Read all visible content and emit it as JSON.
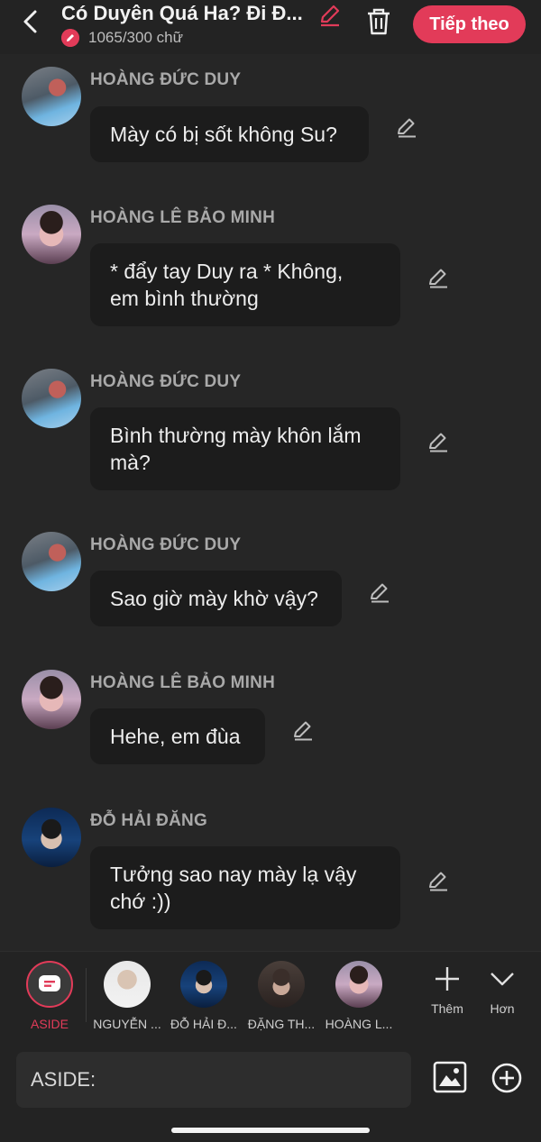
{
  "header": {
    "title": "Có Duyên Quá Ha? Đi Đ...",
    "word_count": "1065/300 chữ",
    "next_label": "Tiếp theo"
  },
  "messages": [
    {
      "sender": "HOÀNG ĐỨC DUY",
      "text": "Mày có bị sốt không Su?"
    },
    {
      "sender": "HOÀNG LÊ BẢO MINH",
      "text": "* đẩy tay Duy ra * Không,",
      "text2": "em bình thường"
    },
    {
      "sender": "HOÀNG ĐỨC DUY",
      "text": "Bình thường mày khôn lắm",
      "text2": "mà?"
    },
    {
      "sender": "HOÀNG ĐỨC DUY",
      "text": "Sao giờ mày khờ vậy?"
    },
    {
      "sender": "HOÀNG LÊ BẢO MINH",
      "text": "Hehe, em đùa"
    },
    {
      "sender": "ĐỖ HẢI ĐĂNG",
      "text": "Tưởng sao nay mày lạ vậy",
      "text2": "chớ :))"
    }
  ],
  "characters": [
    {
      "name": "ASIDE"
    },
    {
      "name": "NGUYỄN ..."
    },
    {
      "name": "ĐỖ HẢI Đ..."
    },
    {
      "name": "ĐẶNG TH..."
    },
    {
      "name": "HOÀNG L..."
    }
  ],
  "tools": {
    "add_label": "Thêm",
    "more_label": "Hơn"
  },
  "input": {
    "prefix": "ASIDE:"
  },
  "colors": {
    "accent": "#e23b59",
    "background": "#262626",
    "bubble": "#1c1c1c"
  }
}
